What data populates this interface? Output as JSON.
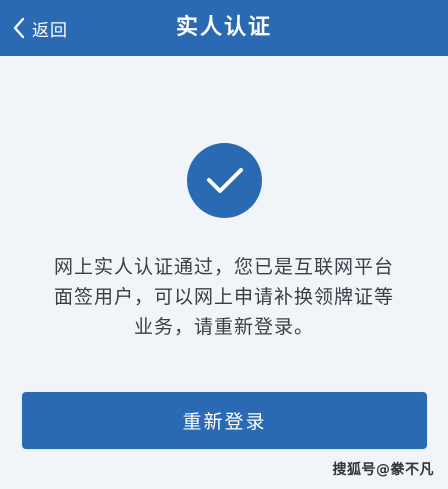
{
  "header": {
    "back_label": "返回",
    "title": "实人认证",
    "back_icon": "chevron-left-icon",
    "background_color": "#2a6ab3"
  },
  "main": {
    "success_icon": "checkmark-icon",
    "message": "网上实人认证通过，您已是互联网平台面签用户，可以网上申请补换领牌证等业务，请重新登录。",
    "relogin_button_label": "重新登录",
    "accent_color": "#2a6ab3"
  },
  "watermark": {
    "text": "搜狐号@豢不凡"
  }
}
